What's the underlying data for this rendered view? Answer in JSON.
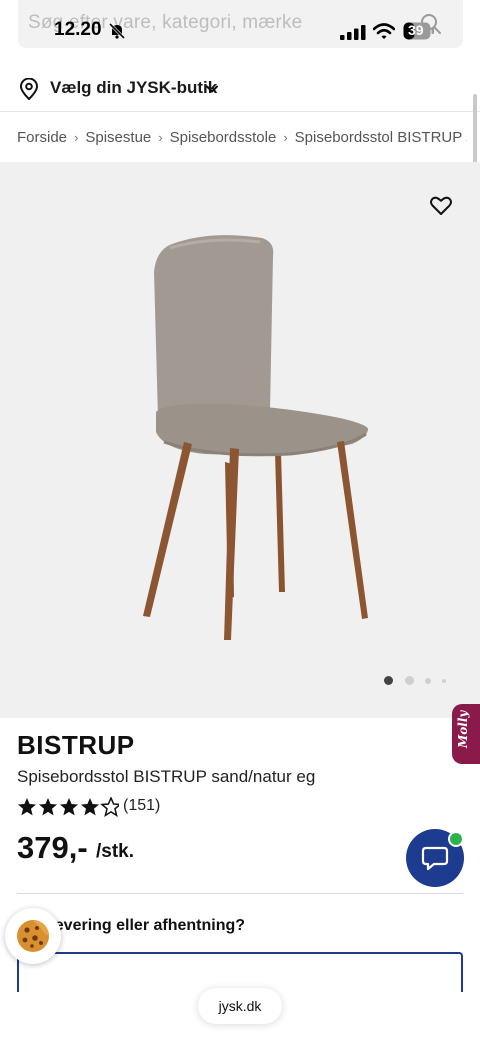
{
  "status_bar": {
    "time": "12.20",
    "battery": "39"
  },
  "search": {
    "placeholder": "Søg efter vare, kategori, mærke"
  },
  "store": {
    "label": "Vælg din JYSK-butik"
  },
  "breadcrumb": {
    "items": [
      "Forside",
      "Spisestue",
      "Spisebordsstole",
      "Spisebordsstol BISTRUP sand/natur eg"
    ]
  },
  "gallery": {
    "image_count": 4,
    "active_index": 0
  },
  "molly": {
    "label": "Molly"
  },
  "product": {
    "name": "BISTRUP",
    "subtitle": "Spisebordsstol BISTRUP sand/natur eg",
    "rating": 4.5,
    "rating_count": "(151)",
    "price": "379,-",
    "price_unit": "/stk."
  },
  "delivery": {
    "label": "Levering eller afhentning?"
  },
  "browser": {
    "url": "jysk.dk"
  },
  "colors": {
    "brand_blue": "#1d3b8f",
    "molly": "#8a1a4a",
    "online": "#2cb34a"
  }
}
